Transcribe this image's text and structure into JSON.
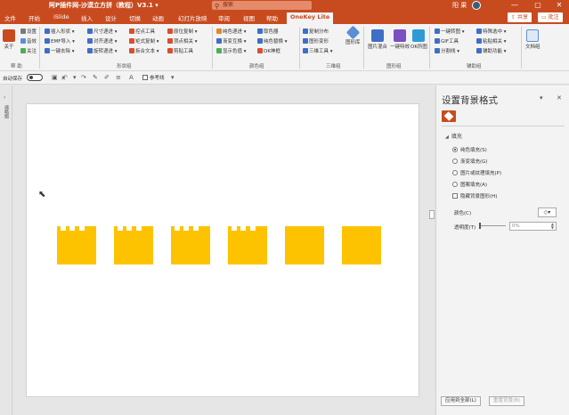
{
  "window": {
    "title": "阿P插件网-沙漠立方拼（教程）V3.1 ▾",
    "search_placeholder": "搜索",
    "user_name": "阳 果",
    "controls": [
      "—",
      "▢",
      "✕"
    ]
  },
  "tabs": [
    "文件",
    "开始",
    "iSlide",
    "插入",
    "设计",
    "切换",
    "动画",
    "幻灯片放映",
    "审阅",
    "视图",
    "帮助",
    "OneKey Lite"
  ],
  "active_tab": "OneKey Lite",
  "share_label": "共享",
  "comment_label": "批注",
  "ribbon": {
    "about": {
      "big": "关于",
      "items": [
        "设置",
        "音效",
        "关注"
      ],
      "label": "帮 助"
    },
    "shape_group": {
      "items": [
        "插入形状 ▾",
        "尺寸递进 ▾",
        "控点工具",
        "原位复制 ▾",
        "EMF导入 ▾",
        "对齐递进 ▾",
        "矩式复制 ▾",
        "顶点相关 ▾",
        "一键去除 ▾",
        "旋转递进 ▾",
        "拆合文本 ▾",
        "剪贴工具"
      ],
      "label": "形状组"
    },
    "color_group": {
      "items": [
        "纯色递进 ▾",
        "取色器",
        "渐变互换 ▾",
        "纯色替换 ▾",
        "显示色值 ▾",
        "OK神框"
      ],
      "label": "颜色组"
    },
    "three_group": {
      "items": [
        "复制分布",
        "图形变形",
        "三维工具 ▾"
      ],
      "big": "图形库",
      "label": "三维组"
    },
    "image_group": {
      "big_items": [
        "图片混合",
        "一键特效",
        "OK所图"
      ],
      "label": "图形组"
    },
    "aux_group": {
      "items": [
        "一键转图 ▾",
        "特殊选中 ▾",
        "GIF工具",
        "粘贴相关 ▾",
        "分割线 ▾",
        "辅助功能 ▾"
      ],
      "big": "文档组",
      "label": "辅助组"
    }
  },
  "quickbar": {
    "autosave": "自动保存",
    "toggle": "关",
    "reference_line": "参考线"
  },
  "left_panel": {
    "label": "缩略图"
  },
  "slide": {
    "pieces": [
      {
        "notches": [
          0.1,
          0.3,
          0.55
        ]
      },
      {
        "notches": [
          0.1,
          0.3,
          0.55
        ]
      },
      {
        "notches": [
          0.1,
          0.3,
          0.55
        ]
      },
      {
        "notches": [
          0.1,
          0.3,
          0.55
        ]
      },
      {
        "notches": []
      },
      {
        "notches": []
      }
    ],
    "piece_color": "#fdc300"
  },
  "format_pane": {
    "title": "设置背景格式",
    "section": "填充",
    "options": [
      {
        "label": "纯色填充(S)",
        "selected": true
      },
      {
        "label": "渐变填充(G)",
        "selected": false
      },
      {
        "label": "图片或纹理填充(P)",
        "selected": false
      },
      {
        "label": "图案填充(A)",
        "selected": false
      }
    ],
    "hide_bg": "隐藏背景图形(H)",
    "color_label": "颜色(C)",
    "transparency_label": "透明度(T)",
    "transparency_value": "0%",
    "apply_all": "应用到全部(L)",
    "reset": "重置背景(B)"
  },
  "colors": {
    "accent": "#c84b1f",
    "puzzle": "#fdc300"
  }
}
